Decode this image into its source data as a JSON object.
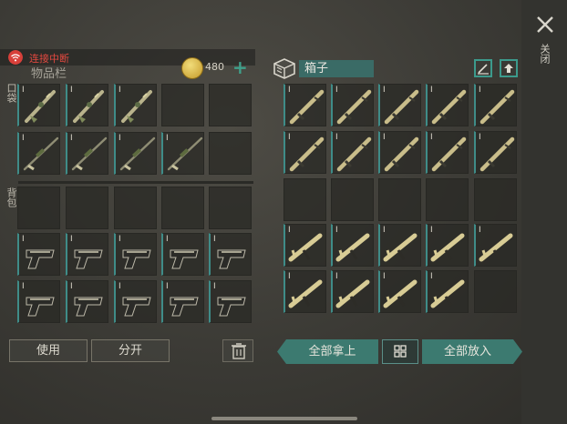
{
  "connection": {
    "status": "连接中断",
    "icon": "wifi-icon"
  },
  "inventory": {
    "title": "物品栏",
    "currency": "480",
    "add_label": "+",
    "section_pocket": "口袋",
    "section_backpack": "背包"
  },
  "actions": {
    "use": "使用",
    "split": "分开",
    "trash": "trash-icon"
  },
  "container": {
    "name": "箱子",
    "take_all": "全部拿上",
    "put_all": "全部放入"
  },
  "close": {
    "label": "关闭",
    "icon": "close-icon"
  },
  "left_grid": [
    "rifle-ornate",
    "rifle-ornate",
    "rifle-ornate",
    "empty",
    "empty",
    "sniper",
    "sniper",
    "sniper",
    "sniper",
    "empty",
    "empty",
    "empty",
    "empty",
    "empty",
    "empty",
    "pistol",
    "pistol",
    "pistol",
    "pistol",
    "pistol",
    "pistol",
    "pistol",
    "pistol",
    "pistol",
    "pistol"
  ],
  "right_grid": [
    "launcher",
    "launcher",
    "launcher",
    "launcher",
    "launcher",
    "launcher",
    "launcher",
    "launcher",
    "launcher",
    "launcher",
    "empty",
    "empty",
    "empty",
    "empty",
    "empty",
    "smg",
    "smg",
    "smg",
    "smg",
    "smg",
    "smg",
    "smg",
    "smg",
    "smg",
    "empty"
  ],
  "colors": {
    "accent": "#3f9a8c",
    "alert": "#e0483f",
    "gold": "#d9b74a"
  }
}
